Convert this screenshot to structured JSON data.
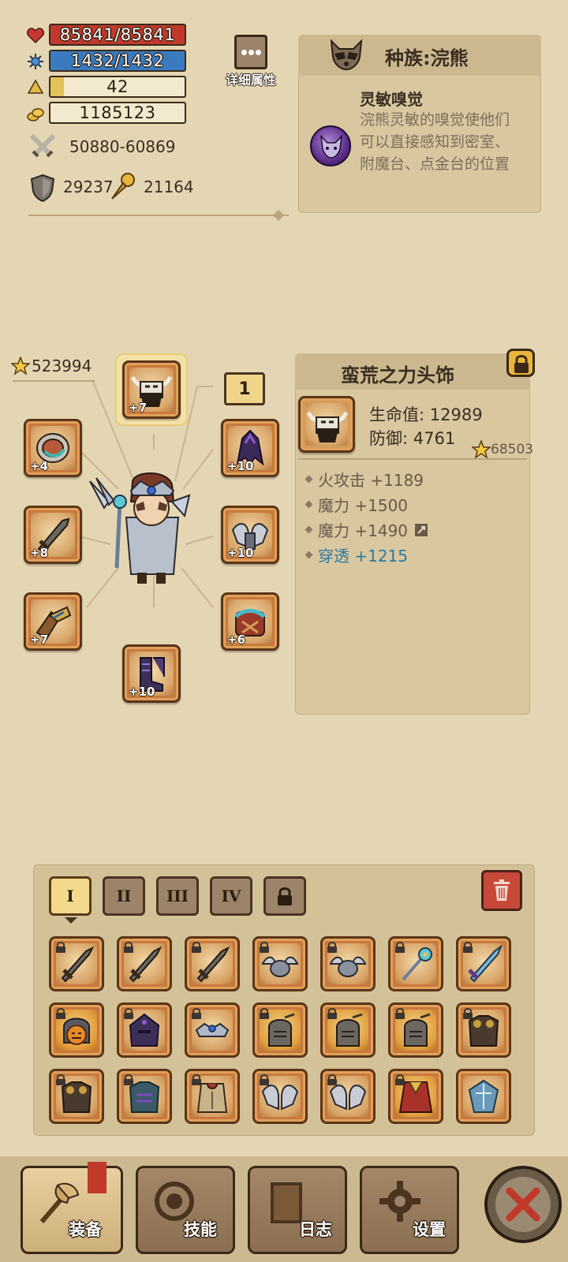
{
  "stats": {
    "hp": "85841/85841",
    "hp_fill": 1.0,
    "mana": "1432/1432",
    "mana_fill": 1.0,
    "level": "42",
    "xp_fill": 0.1,
    "gold": "1185123",
    "attack": "50880-60869",
    "defense": "29237",
    "power": "21164"
  },
  "detail_button": {
    "label": "详细属性"
  },
  "race": {
    "title": "种族:浣熊",
    "skill_name": "灵敏嗅觉",
    "skill_desc": "浣熊灵敏的嗅觉使他们可以直接感知到密室、附魔台、点金台的位置"
  },
  "equipment": {
    "score": "523994",
    "slot_badge": "1",
    "slots": [
      {
        "name": "helmet",
        "plus": "+7"
      },
      {
        "name": "bracer",
        "plus": "+4"
      },
      {
        "name": "weapon",
        "plus": "+8"
      },
      {
        "name": "gloves",
        "plus": "+7"
      },
      {
        "name": "cape",
        "plus": "+10"
      },
      {
        "name": "shoulders",
        "plus": "+10"
      },
      {
        "name": "belt",
        "plus": "+6"
      },
      {
        "name": "boots",
        "plus": "+10"
      }
    ]
  },
  "item_detail": {
    "title": "蛮荒之力头饰",
    "hp": "生命值: 12989",
    "def": "防御: 4761",
    "score": "68503",
    "affixes": [
      {
        "text": "火攻击 +1189",
        "color": "#6a5a48"
      },
      {
        "text": "魔力 +1500",
        "color": "#6a5a48"
      },
      {
        "text": "魔力 +1490",
        "color": "#6a5a48"
      },
      {
        "text": "穿透 +1215",
        "color": "#2d7aa0"
      }
    ]
  },
  "inventory": {
    "tabs": [
      "I",
      "II",
      "III",
      "IV"
    ],
    "active_tab": "I"
  },
  "nav": {
    "equip": "装备",
    "skills": "技能",
    "log": "日志",
    "settings": "设置"
  },
  "colors": {
    "hp": "#c0392b",
    "mana": "#3a7bbf",
    "xp": "#e2c25a",
    "accent_blue": "#2d7aa0"
  }
}
